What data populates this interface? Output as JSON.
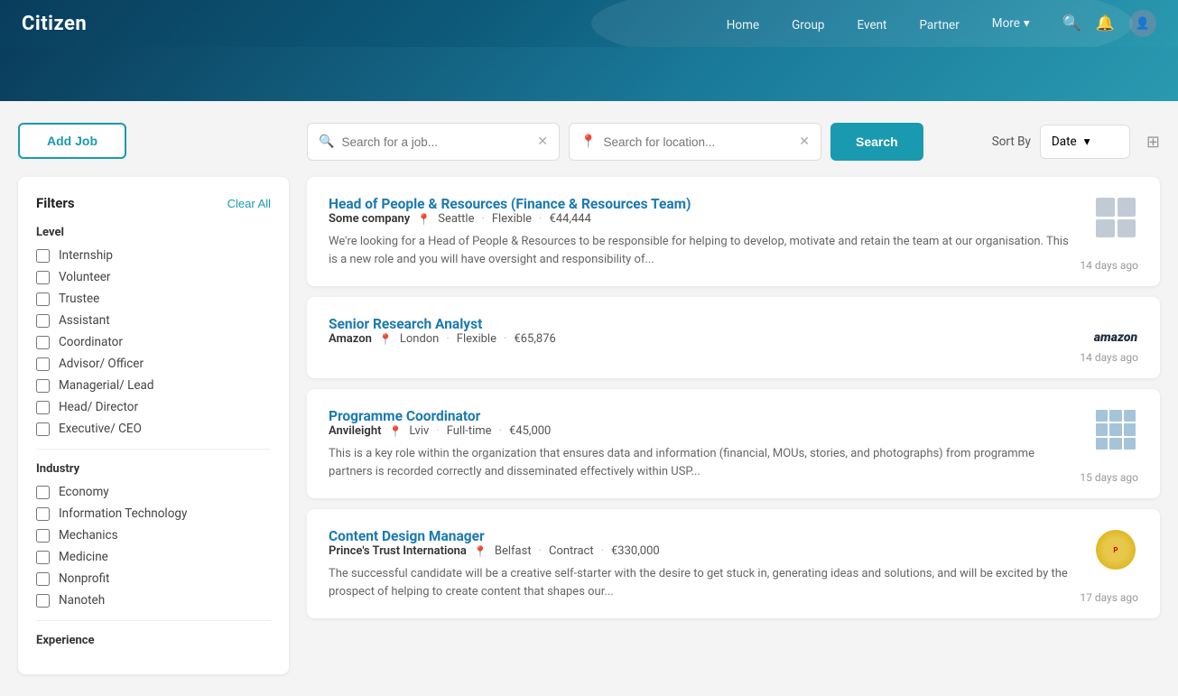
{
  "nav": {
    "logo": "Citizen",
    "links": [
      "Home",
      "Group",
      "Event",
      "Partner"
    ],
    "more_label": "More"
  },
  "search": {
    "job_placeholder": "Search for a job...",
    "location_placeholder": "Search for location...",
    "button_label": "Search",
    "sort_by_label": "Sort By",
    "sort_option": "Date"
  },
  "sidebar": {
    "add_job_label": "Add Job",
    "filters_title": "Filters",
    "clear_all_label": "Clear All",
    "level_section": "Level",
    "level_items": [
      "Internship",
      "Volunteer",
      "Trustee",
      "Assistant",
      "Coordinator",
      "Advisor/ Officer",
      "Managerial/ Lead",
      "Head/ Director",
      "Executive/ CEO"
    ],
    "industry_section": "Industry",
    "industry_items": [
      "Economy",
      "Information Technology",
      "Mechanics",
      "Medicine",
      "Nonprofit",
      "Nanoteh"
    ],
    "experience_section": "Experience"
  },
  "jobs": [
    {
      "id": 1,
      "title": "Head of People & Resources (Finance & Resources Team)",
      "company": "Some company",
      "location": "Seattle",
      "tag": "Flexible",
      "salary": "€44,444",
      "description": "We're looking for a Head of People & Resources to be responsible for helping to develop, motivate and retain the team at our organisation. This is a new role and you will have oversight and responsibility of...",
      "date": "14 days ago",
      "logo_type": "grid"
    },
    {
      "id": 2,
      "title": "Senior Research Analyst",
      "company": "Amazon",
      "location": "London",
      "tag": "Flexible",
      "salary": "€65,876",
      "description": "",
      "date": "14 days ago",
      "logo_type": "amazon"
    },
    {
      "id": 3,
      "title": "Programme Coordinator",
      "company": "Anvileight",
      "location": "Lviv",
      "tag": "Full-time",
      "salary": "€45,000",
      "description": "This is a key role within the organization that ensures data and information (financial, MOUs, stories, and photographs) from programme partners is recorded correctly and disseminated effectively within USP...",
      "date": "15 days ago",
      "logo_type": "anvil"
    },
    {
      "id": 4,
      "title": "Content Design Manager",
      "company": "Prince's Trust Internationa",
      "location": "Belfast",
      "tag": "Contract",
      "salary": "€330,000",
      "description": "The successful candidate will be a creative self-starter with the desire to get stuck in, generating ideas and solutions, and will be excited by the prospect of helping to create content that shapes our...",
      "date": "17 days ago",
      "logo_type": "pringles"
    }
  ]
}
